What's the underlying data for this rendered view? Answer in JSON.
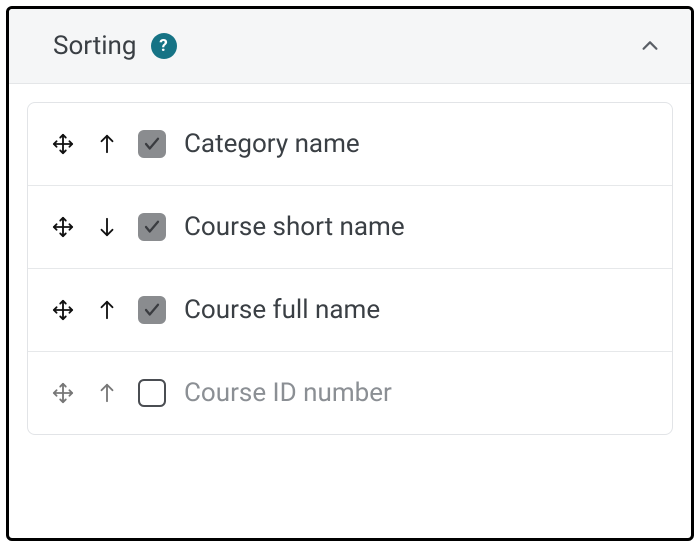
{
  "panel": {
    "title": "Sorting"
  },
  "items": [
    {
      "label": "Category name",
      "checked": true,
      "direction": "up"
    },
    {
      "label": "Course short name",
      "checked": true,
      "direction": "down"
    },
    {
      "label": "Course full name",
      "checked": true,
      "direction": "up"
    },
    {
      "label": "Course ID number",
      "checked": false,
      "direction": "up"
    }
  ]
}
